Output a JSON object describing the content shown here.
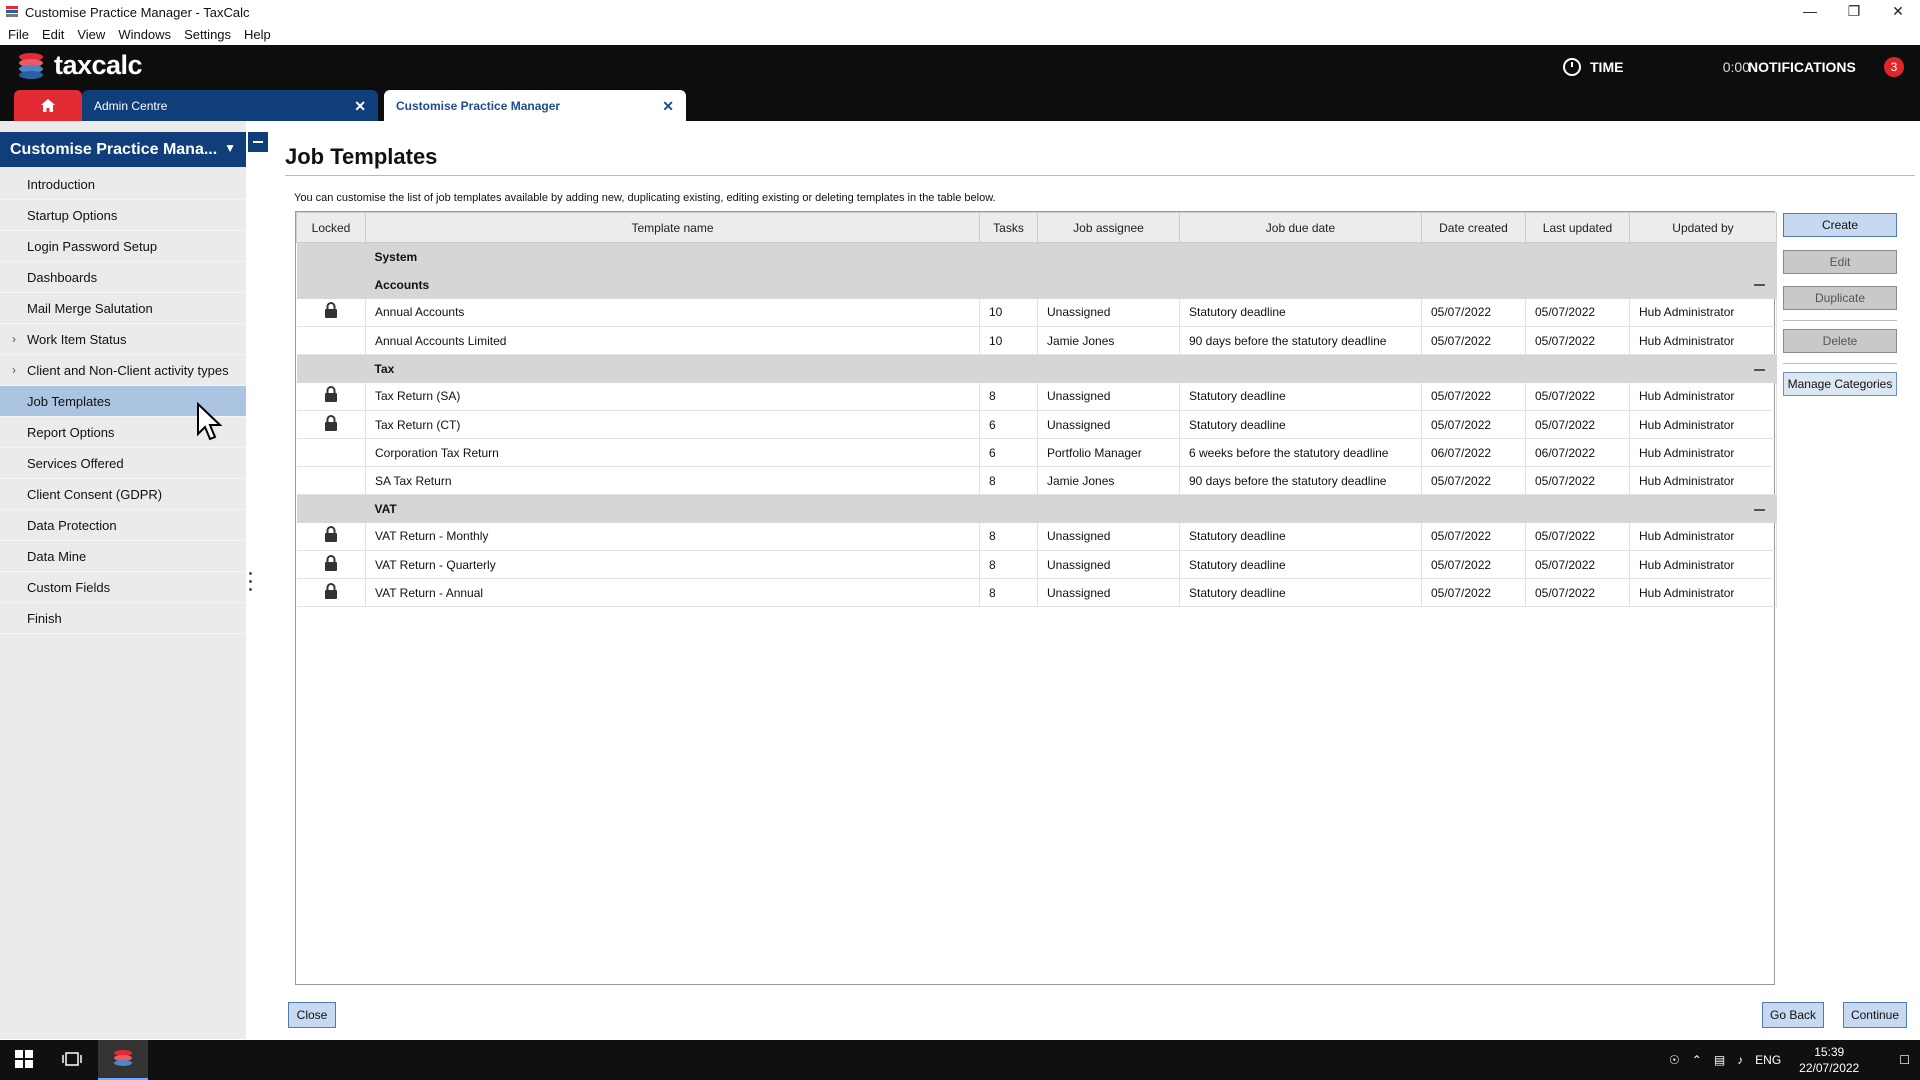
{
  "window": {
    "title": "Customise Practice Manager - TaxCalc"
  },
  "menu": [
    "File",
    "Edit",
    "View",
    "Windows",
    "Settings",
    "Help"
  ],
  "header": {
    "logo_text": "taxcalc",
    "time_label": "TIME",
    "time_value": "0:00",
    "notifications_label": "NOTIFICATIONS",
    "notifications_count": "3"
  },
  "tabs": [
    {
      "label": "Admin Centre"
    },
    {
      "label": "Customise Practice Manager"
    }
  ],
  "sidebar": {
    "title": "Customise Practice Mana...",
    "items": [
      {
        "label": "Introduction",
        "expandable": false
      },
      {
        "label": "Startup Options",
        "expandable": false
      },
      {
        "label": "Login Password Setup",
        "expandable": false
      },
      {
        "label": "Dashboards",
        "expandable": false
      },
      {
        "label": "Mail Merge Salutation",
        "expandable": false
      },
      {
        "label": "Work Item Status",
        "expandable": true
      },
      {
        "label": "Client and Non-Client activity types",
        "expandable": true
      },
      {
        "label": "Job Templates",
        "expandable": false,
        "active": true
      },
      {
        "label": "Report Options",
        "expandable": false
      },
      {
        "label": "Services Offered",
        "expandable": false
      },
      {
        "label": "Client Consent (GDPR)",
        "expandable": false
      },
      {
        "label": "Data Protection",
        "expandable": false
      },
      {
        "label": "Data Mine",
        "expandable": false
      },
      {
        "label": "Custom Fields",
        "expandable": false
      },
      {
        "label": "Finish",
        "expandable": false
      }
    ]
  },
  "main": {
    "title": "Job Templates",
    "intro": "You can customise the list of job templates available by adding new, duplicating existing, editing existing or deleting templates in the table below.",
    "columns": [
      "Locked",
      "Template name",
      "Tasks",
      "Job assignee",
      "Job due date",
      "Date created",
      "Last updated",
      "Updated by"
    ],
    "root_group": "System",
    "groups": [
      {
        "name": "Accounts",
        "rows": [
          {
            "locked": true,
            "name": "Annual Accounts",
            "tasks": "10",
            "assignee": "Unassigned",
            "due": "Statutory deadline",
            "created": "05/07/2022",
            "updated": "05/07/2022",
            "updated_by": "Hub Administrator"
          },
          {
            "locked": false,
            "name": "Annual Accounts Limited",
            "tasks": "10",
            "assignee": "Jamie Jones",
            "due": "90 days before the statutory deadline",
            "created": "05/07/2022",
            "updated": "05/07/2022",
            "updated_by": "Hub Administrator"
          }
        ]
      },
      {
        "name": "Tax",
        "rows": [
          {
            "locked": true,
            "name": "Tax Return (SA)",
            "tasks": "8",
            "assignee": "Unassigned",
            "due": "Statutory deadline",
            "created": "05/07/2022",
            "updated": "05/07/2022",
            "updated_by": "Hub Administrator"
          },
          {
            "locked": true,
            "name": "Tax Return (CT)",
            "tasks": "6",
            "assignee": "Unassigned",
            "due": "Statutory deadline",
            "created": "05/07/2022",
            "updated": "05/07/2022",
            "updated_by": "Hub Administrator"
          },
          {
            "locked": false,
            "name": "Corporation Tax Return",
            "tasks": "6",
            "assignee": "Portfolio Manager",
            "due": "6 weeks before the statutory deadline",
            "created": "06/07/2022",
            "updated": "06/07/2022",
            "updated_by": "Hub Administrator"
          },
          {
            "locked": false,
            "name": "SA Tax Return",
            "tasks": "8",
            "assignee": "Jamie Jones",
            "due": "90 days before the statutory deadline",
            "created": "05/07/2022",
            "updated": "05/07/2022",
            "updated_by": "Hub Administrator"
          }
        ]
      },
      {
        "name": "VAT",
        "rows": [
          {
            "locked": true,
            "name": "VAT Return - Monthly",
            "tasks": "8",
            "assignee": "Unassigned",
            "due": "Statutory deadline",
            "created": "05/07/2022",
            "updated": "05/07/2022",
            "updated_by": "Hub Administrator"
          },
          {
            "locked": true,
            "name": "VAT Return - Quarterly",
            "tasks": "8",
            "assignee": "Unassigned",
            "due": "Statutory deadline",
            "created": "05/07/2022",
            "updated": "05/07/2022",
            "updated_by": "Hub Administrator"
          },
          {
            "locked": true,
            "name": "VAT Return - Annual",
            "tasks": "8",
            "assignee": "Unassigned",
            "due": "Statutory deadline",
            "created": "05/07/2022",
            "updated": "05/07/2022",
            "updated_by": "Hub Administrator"
          }
        ]
      }
    ],
    "actions": {
      "create": "Create",
      "edit": "Edit",
      "duplicate": "Duplicate",
      "delete": "Delete",
      "manage_categories": "Manage Categories"
    },
    "footer": {
      "close": "Close",
      "go_back": "Go Back",
      "continue": "Continue"
    }
  },
  "taskbar": {
    "language": "ENG",
    "time": "15:39",
    "date": "22/07/2022"
  },
  "colors": {
    "brand_blue": "#103e7a",
    "brand_red": "#e32b36",
    "active_item": "#aac4e2",
    "header_bg": "#0d0d0d"
  }
}
